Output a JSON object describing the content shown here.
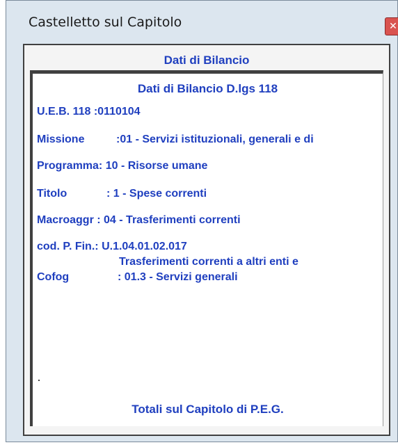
{
  "window": {
    "title": "Castelletto sul Capitolo",
    "close_symbol": "✕"
  },
  "panel": {
    "header": "Dati di Bilancio",
    "sub_header": "Dati di Bilancio D.lgs 118",
    "rows": [
      {
        "label": "U.E.B. 118 :",
        "value": "0110104"
      },
      {
        "label": "Missione",
        "value": ":01 - Servizi istituzionali, generali e di"
      },
      {
        "label": "Programma:",
        "value": "10 - Risorse umane"
      },
      {
        "label": "Titolo",
        "value": ": 1 - Spese correnti"
      },
      {
        "label": "Macroaggr :",
        "value": "04 - Trasferimenti correnti"
      },
      {
        "label": "cod. P. Fin.:",
        "value": "U.1.04.01.02.017",
        "extra": "Trasferimenti correnti a altri enti e"
      },
      {
        "label": "Cofog",
        "value": ": 01.3 - Servizi generali"
      }
    ],
    "footer": "Totali sul Capitolo di P.E.G."
  },
  "colors": {
    "text_blue": "#1f3fbf",
    "window_bg": "#dce6ef",
    "close_red": "#d9534f"
  }
}
